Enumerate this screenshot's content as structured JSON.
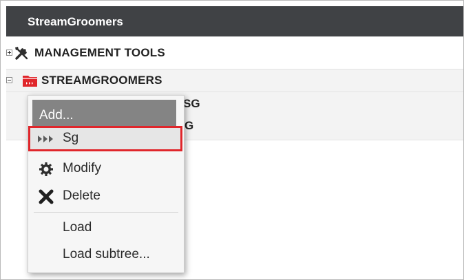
{
  "panel": {
    "title": "StreamGroomers"
  },
  "tree": {
    "items": [
      {
        "label": "MANAGEMENT TOOLS",
        "icon": "tools-icon",
        "expanded": false
      },
      {
        "label": "STREAMGROOMERS",
        "icon": "folder-icon",
        "expanded": true
      }
    ],
    "children_partial": [
      "SG",
      "G"
    ]
  },
  "context_menu": {
    "items": [
      {
        "label": "Add...",
        "icon": ""
      },
      {
        "label": "Sg",
        "icon": "triple-arrow-icon",
        "highlighted": true
      },
      {
        "label": "Modify",
        "icon": "gear-icon"
      },
      {
        "label": "Delete",
        "icon": "close-x-icon"
      },
      {
        "label": "Load",
        "icon": ""
      },
      {
        "label": "Load subtree...",
        "icon": ""
      }
    ]
  },
  "colors": {
    "header_bg": "#404245",
    "folder_icon": "#e0262b",
    "highlight_border": "#e0262b",
    "add_item_bg": "#848484"
  }
}
